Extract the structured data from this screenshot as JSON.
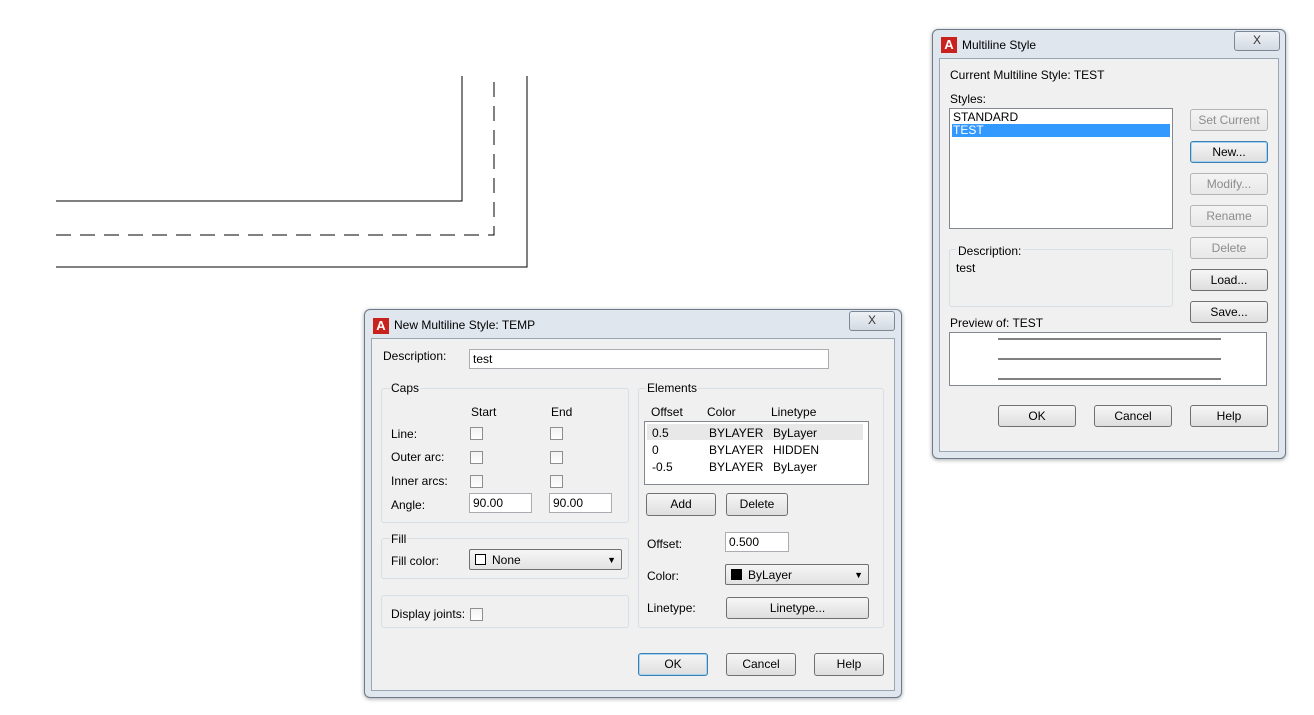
{
  "new_style_dialog": {
    "title": "New Multiline Style: TEMP",
    "close_label": "X",
    "description_label": "Description:",
    "description_value": "test",
    "caps": {
      "group_label": "Caps",
      "start_header": "Start",
      "end_header": "End",
      "line_label": "Line:",
      "outer_arc_label": "Outer arc:",
      "inner_arcs_label": "Inner arcs:",
      "angle_label": "Angle:",
      "angle_start": "90.00",
      "angle_end": "90.00"
    },
    "fill": {
      "group_label": "Fill",
      "color_label": "Fill color:",
      "color_value": "None"
    },
    "display_joints_label": "Display joints:",
    "elements": {
      "group_label": "Elements",
      "headers": [
        "Offset",
        "Color",
        "Linetype"
      ],
      "rows": [
        {
          "offset": "0.5",
          "color": "BYLAYER",
          "linetype": "ByLayer"
        },
        {
          "offset": "0",
          "color": "BYLAYER",
          "linetype": "HIDDEN"
        },
        {
          "offset": "-0.5",
          "color": "BYLAYER",
          "linetype": "ByLayer"
        }
      ],
      "add_label": "Add",
      "delete_label": "Delete",
      "offset_label": "Offset:",
      "offset_value": "0.500",
      "color_label": "Color:",
      "color_value": "ByLayer",
      "linetype_label": "Linetype:",
      "linetype_button": "Linetype..."
    },
    "ok_label": "OK",
    "cancel_label": "Cancel",
    "help_label": "Help"
  },
  "multiline_style_dialog": {
    "title": "Multiline Style",
    "close_label": "X",
    "current_style_text": "Current Multiline Style: TEST",
    "styles_label": "Styles:",
    "styles": [
      "STANDARD",
      "TEST"
    ],
    "selected_style": "TEST",
    "description_label": "Description:",
    "description_value": "test",
    "preview_label": "Preview of: TEST",
    "buttons": {
      "set_current": "Set Current",
      "new": "New...",
      "modify": "Modify...",
      "rename": "Rename",
      "delete": "Delete",
      "load": "Load...",
      "save": "Save..."
    },
    "ok_label": "OK",
    "cancel_label": "Cancel",
    "help_label": "Help"
  },
  "colors": {
    "selection": "#3399ff",
    "app_icon": "#c9211e",
    "window_frame": "#dfe6ee"
  },
  "icons": {
    "app": "autocad-logo-icon",
    "dropdown": "chevron-down-icon"
  }
}
